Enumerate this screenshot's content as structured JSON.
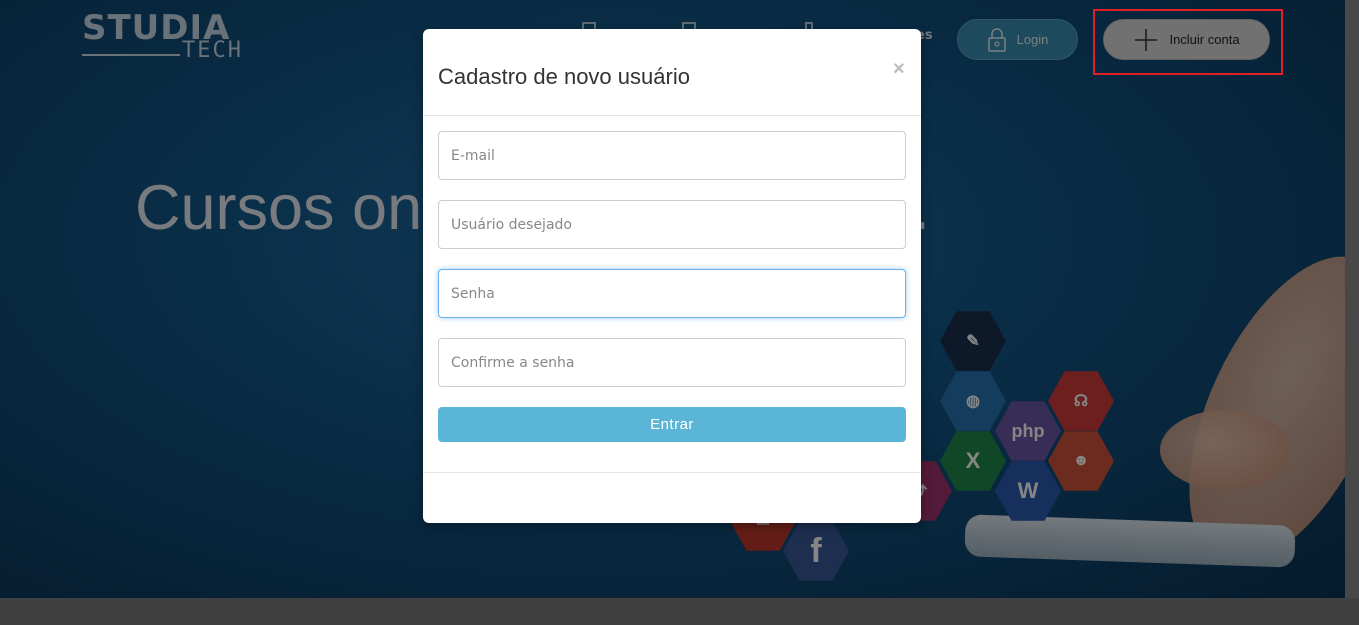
{
  "logo": {
    "main": "STUDIA",
    "sub": "TECH"
  },
  "nav": {
    "partial_label": "es",
    "login_label": "Login",
    "include_label": "Incluir conta"
  },
  "hero": {
    "title": "Cursos online de tecnologia."
  },
  "hexagons": [
    {
      "label": "php",
      "color": "#6a56a8"
    },
    {
      "label": "X",
      "color": "#1f8a4c"
    },
    {
      "label": "W",
      "color": "#2b5bb0"
    },
    {
      "label": "f",
      "color": "#3b5998"
    },
    {
      "label": "✉",
      "color": "#d23c3c"
    }
  ],
  "modal": {
    "title": "Cadastro de novo usuário",
    "close": "×",
    "email_placeholder": "E-mail",
    "username_placeholder": "Usuário desejado",
    "password_placeholder": "Senha",
    "confirm_placeholder": "Confirme a senha",
    "submit_label": "Entrar"
  }
}
